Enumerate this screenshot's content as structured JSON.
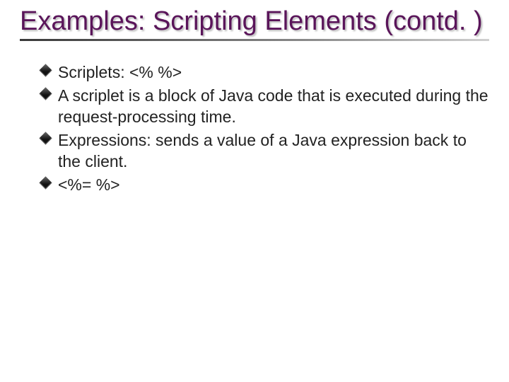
{
  "title": "Examples: Scripting Elements (contd. )",
  "bullets": [
    "Scriplets: <%    %>",
    "A scriplet is a block of Java code that is executed during the request-processing time.",
    "Expressions: sends a value of a Java expression back to the client.",
    "<%=  %>"
  ]
}
